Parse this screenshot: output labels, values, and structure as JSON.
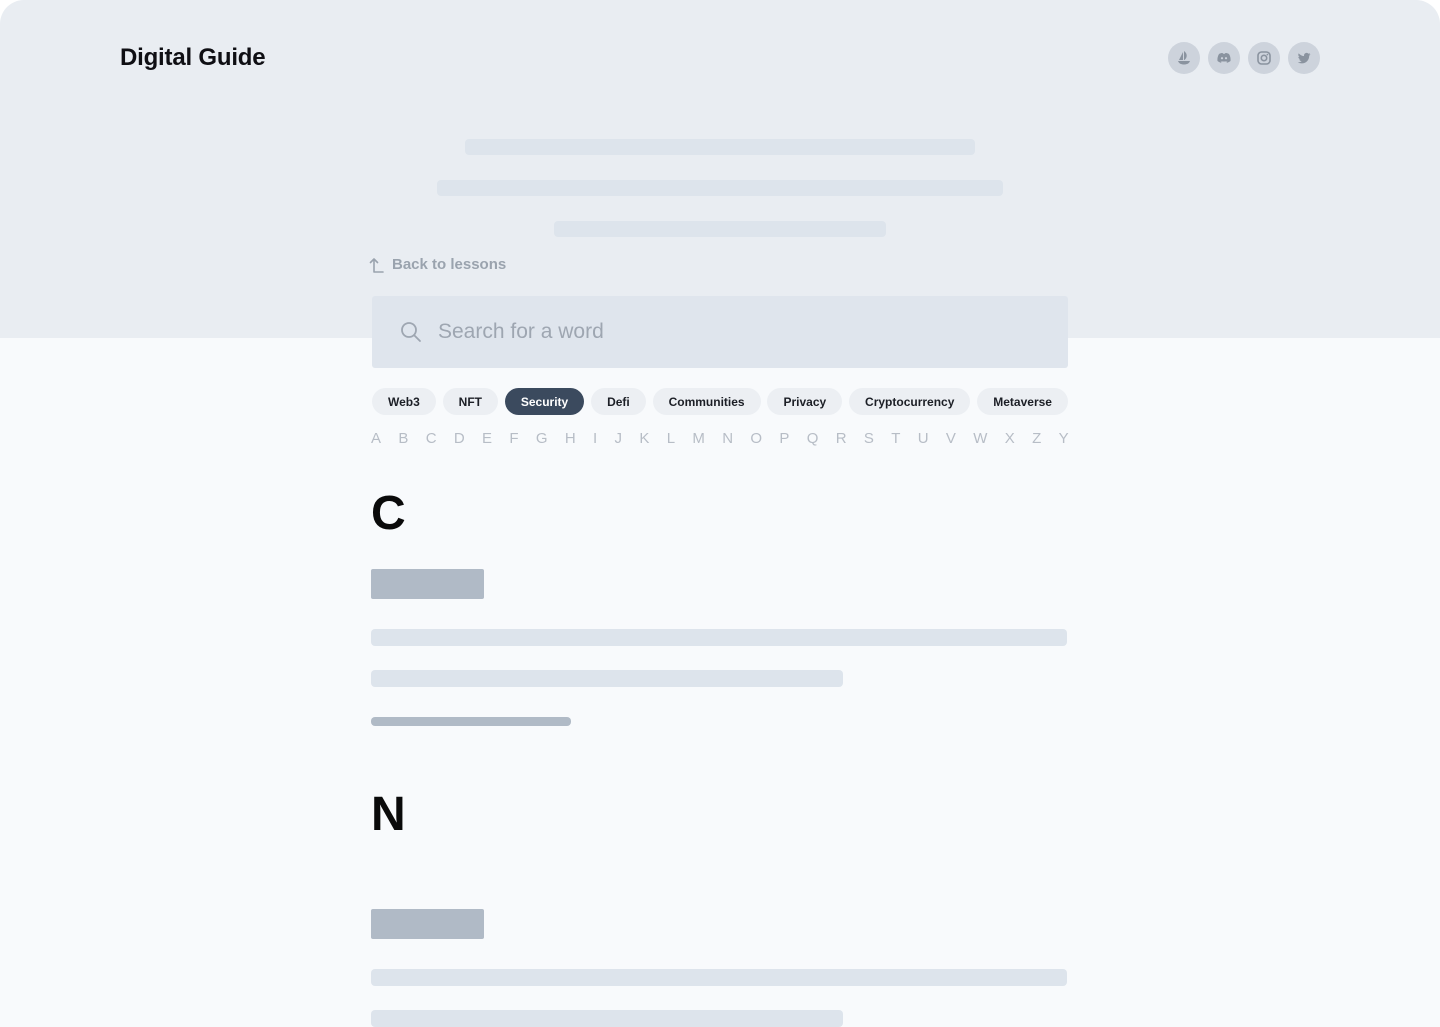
{
  "header": {
    "logo": "Digital Guide",
    "socials": [
      {
        "name": "opensea-icon"
      },
      {
        "name": "discord-icon"
      },
      {
        "name": "instagram-icon"
      },
      {
        "name": "twitter-icon"
      }
    ]
  },
  "nav": {
    "back_label": "Back to lessons"
  },
  "search": {
    "placeholder": "Search for a word",
    "value": ""
  },
  "tags": [
    "Web3",
    "NFT",
    "Security",
    "Defi",
    "Communities",
    "Privacy",
    "Cryptocurrency",
    "Metaverse"
  ],
  "active_tag": "Security",
  "alphabet": [
    "A",
    "B",
    "C",
    "D",
    "E",
    "F",
    "G",
    "H",
    "I",
    "J",
    "K",
    "L",
    "M",
    "N",
    "O",
    "P",
    "Q",
    "R",
    "S",
    "T",
    "U",
    "V",
    "W",
    "X",
    "Z",
    "Y"
  ],
  "sections": [
    {
      "letter": "C"
    },
    {
      "letter": "N"
    }
  ],
  "colors": {
    "hero_bg": "#e9edf2",
    "page_bg": "#f8fafc",
    "accent": "#3b4a5e",
    "skeleton_light": "#dde4ec",
    "skeleton_dark": "#b0bac6"
  }
}
